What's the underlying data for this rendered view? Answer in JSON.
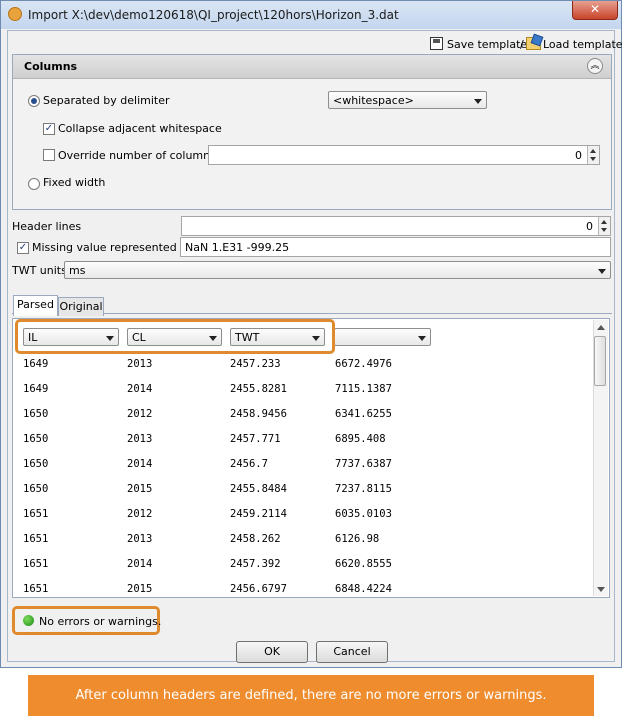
{
  "window": {
    "title": "Import X:\\dev\\demo120618\\QI_project\\120hors\\Horizon_3.dat",
    "close_glyph": "✕"
  },
  "toolbar": {
    "save_template": "Save template",
    "separator": "/",
    "load_template": "Load template"
  },
  "columns_group": {
    "title": "Columns",
    "separated_label": "Separated by delimiter",
    "delimiter_value": "<whitespace>",
    "collapse_label": "Collapse adjacent whitespace",
    "override_label": "Override number of columns",
    "override_value": "0",
    "fixed_width_label": "Fixed width"
  },
  "header_lines": {
    "label": "Header lines",
    "value": "0"
  },
  "missing_value": {
    "label": "Missing value represented by",
    "value": "NaN 1.E31 -999.25"
  },
  "twt_units": {
    "label": "TWT units",
    "value": "ms"
  },
  "tabs": [
    {
      "label": "Parsed"
    },
    {
      "label": "Original"
    }
  ],
  "column_headers": [
    "IL",
    "CL",
    "TWT",
    ""
  ],
  "rows": [
    [
      "1649",
      "2013",
      "2457.233",
      "6672.4976"
    ],
    [
      "1649",
      "2014",
      "2455.8281",
      "7115.1387"
    ],
    [
      "1650",
      "2012",
      "2458.9456",
      "6341.6255"
    ],
    [
      "1650",
      "2013",
      "2457.771",
      "6895.408"
    ],
    [
      "1650",
      "2014",
      "2456.7",
      "7737.6387"
    ],
    [
      "1650",
      "2015",
      "2455.8484",
      "7237.8115"
    ],
    [
      "1651",
      "2012",
      "2459.2114",
      "6035.0103"
    ],
    [
      "1651",
      "2013",
      "2458.262",
      "6126.98"
    ],
    [
      "1651",
      "2014",
      "2457.392",
      "6620.8555"
    ],
    [
      "1651",
      "2015",
      "2456.6797",
      "6848.4224"
    ]
  ],
  "status": {
    "text": "No errors or warnings."
  },
  "buttons": {
    "ok": "OK",
    "cancel": "Cancel"
  },
  "caption": {
    "text": "After column headers are defined, there are no more errors or warnings."
  },
  "colors": {
    "accent_orange": "#ef8c2e",
    "highlight_orange": "#e08a2e",
    "status_green": "#1d8a1a"
  }
}
